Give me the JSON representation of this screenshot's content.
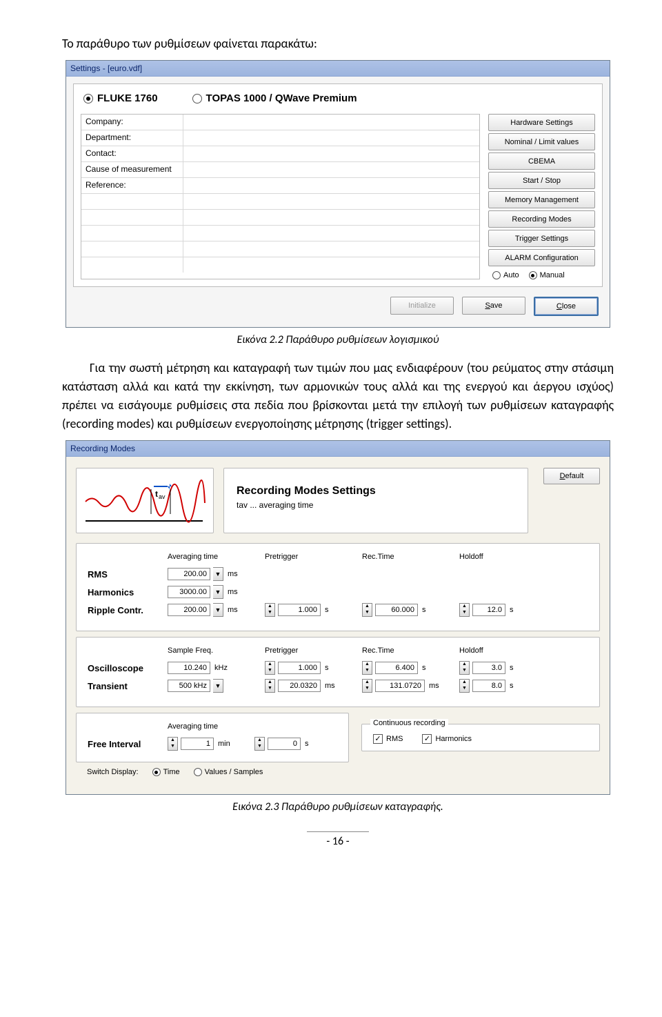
{
  "doc": {
    "intro": "Το παράθυρο των ρυθμίσεων φαίνεται παρακάτω:",
    "caption1": "Εικόνα 2.2 Παράθυρο ρυθμίσεων λογισμικού",
    "midpara": "Για την σωστή μέτρηση και καταγραφή των τιμών που μας ενδιαφέρουν (του ρεύματος στην στάσιμη κατάσταση αλλά και κατά την εκκίνηση, των αρμονικών τους αλλά και της ενεργού και άεργου ισχύος) πρέπει να εισάγουμε ρυθμίσεις στα πεδία που βρίσκονται μετά την επιλογή των ρυθμίσεων καταγραφής (recording modes) και ρυθμίσεων ενεργοποίησης μέτρησης (trigger settings).",
    "caption2": "Εικόνα 2.3 Παράθυρο ρυθμίσεων καταγραφής.",
    "pagenum": "- 16 -"
  },
  "settings": {
    "title": "Settings - [euro.vdf]",
    "radios": {
      "fluke": "FLUKE 1760",
      "topas": "TOPAS 1000 / QWave Premium"
    },
    "rows": [
      "Company:",
      "Department:",
      "Contact:",
      "Cause of measurement",
      "Reference:",
      "",
      "",
      "",
      "",
      ""
    ],
    "sidebuttons": [
      "Hardware Settings",
      "Nominal / Limit values",
      "CBEMA",
      "Start / Stop",
      "Memory Management",
      "Recording Modes",
      "Trigger Settings",
      "ALARM Configuration"
    ],
    "automanual": {
      "auto": "Auto",
      "manual": "Manual"
    },
    "footer": {
      "init": "Initialize",
      "save": "Save",
      "close": "Close"
    }
  },
  "rec": {
    "title": "Recording Modes",
    "boxtitle": "Recording Modes Settings",
    "boxsub": "tav ... averaging time",
    "default": "Default",
    "tav": "tav",
    "headers": {
      "avg": "Averaging time",
      "pre": "Pretrigger",
      "rec": "Rec.Time",
      "hold": "Holdoff",
      "samp": "Sample Freq."
    },
    "rows1": {
      "rms": "RMS",
      "rms_val": "200.00",
      "rms_unit": "ms",
      "harm": "Harmonics",
      "harm_val": "3000.00",
      "harm_unit": "ms",
      "ripple": "Ripple Contr.",
      "ripple_val": "200.00",
      "ripple_unit": "ms",
      "ripple_pre": "1.000",
      "ripple_pre_u": "s",
      "ripple_rec": "60.000",
      "ripple_rec_u": "s",
      "ripple_hold": "12.0",
      "ripple_hold_u": "s"
    },
    "rows2": {
      "osc": "Oscilloscope",
      "osc_sf": "10.240",
      "osc_sf_u": "kHz",
      "osc_pre": "1.000",
      "osc_pre_u": "s",
      "osc_rec": "6.400",
      "osc_rec_u": "s",
      "osc_hold": "3.0",
      "osc_hold_u": "s",
      "trans": "Transient",
      "trans_sf": "500 kHz",
      "trans_pre": "20.0320",
      "trans_pre_u": "ms",
      "trans_rec": "131.0720",
      "trans_rec_u": "ms",
      "trans_hold": "8.0",
      "trans_hold_u": "s"
    },
    "free": {
      "label": "Free Interval",
      "val1": "1",
      "u1": "min",
      "val2": "0",
      "u2": "s",
      "cont": "Continuous recording",
      "rms": "RMS",
      "harm": "Harmonics"
    },
    "switch": {
      "label": "Switch Display:",
      "time": "Time",
      "vals": "Values / Samples"
    }
  }
}
